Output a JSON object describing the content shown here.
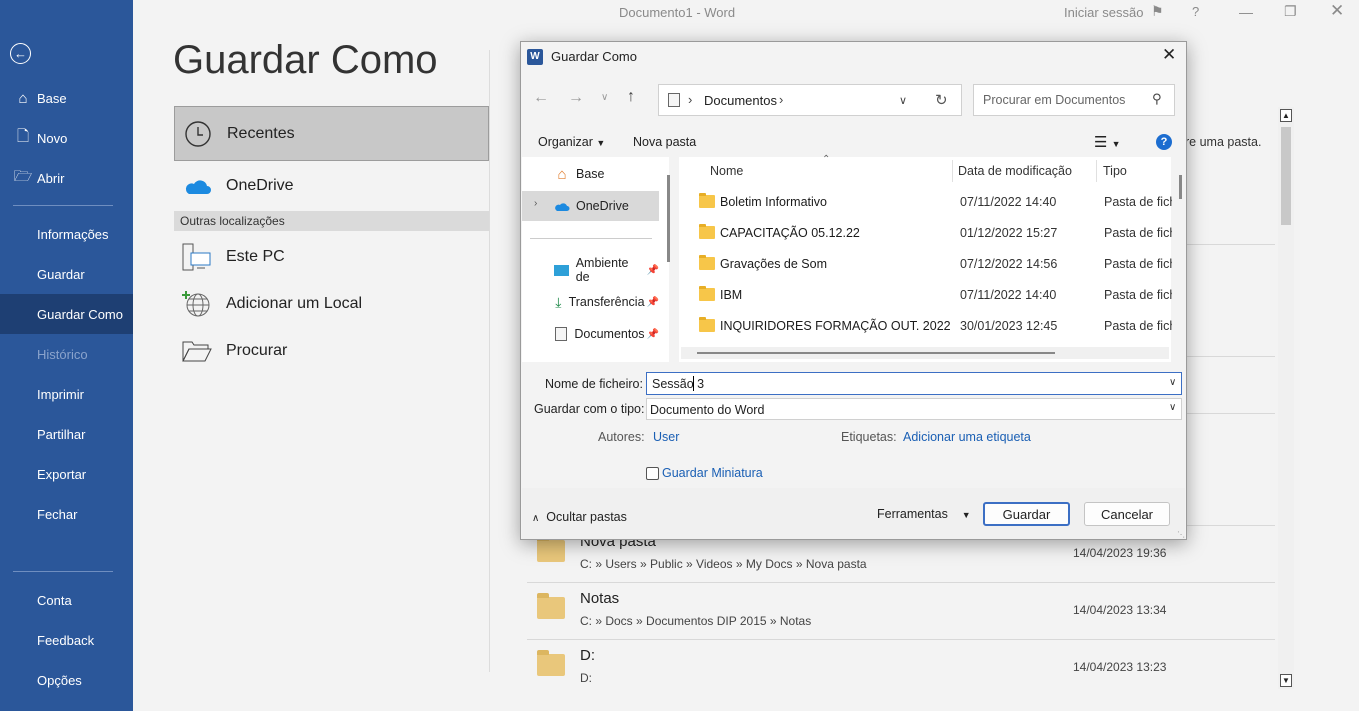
{
  "window": {
    "title": "Documento1  -  Word",
    "signin": "Iniciar sessão",
    "help": "?"
  },
  "rail": {
    "back": "back-arrow",
    "items": [
      {
        "label": "Base",
        "icon": "home-icon"
      },
      {
        "label": "Novo",
        "icon": "new-doc-icon"
      },
      {
        "label": "Abrir",
        "icon": "open-folder-icon"
      },
      {
        "label": "Informações"
      },
      {
        "label": "Guardar"
      },
      {
        "label": "Guardar Como"
      },
      {
        "label": "Histórico"
      },
      {
        "label": "Imprimir"
      },
      {
        "label": "Partilhar"
      },
      {
        "label": "Exportar"
      },
      {
        "label": "Fechar"
      },
      {
        "label": "Conta"
      },
      {
        "label": "Feedback"
      },
      {
        "label": "Opções"
      }
    ]
  },
  "main": {
    "title": "Guardar Como",
    "recent": "Recentes",
    "onedrive": "OneDrive",
    "other_header": "Outras localizações",
    "this_pc": "Este PC",
    "add_place": "Adicionar um Local",
    "browse": "Procurar",
    "hint_partial": "re uma pasta.",
    "recent_folders": [
      {
        "name": "Nova pasta",
        "path": "C: » Users » Public » Videos » My Docs » Nova pasta",
        "date": "14/04/2023 19:36"
      },
      {
        "name": "Notas",
        "path": "C: » Docs » Documentos DIP 2015 » Notas",
        "date": "14/04/2023 13:34"
      },
      {
        "name": "D:",
        "path": "D:",
        "date": "14/04/2023 13:23"
      }
    ]
  },
  "dialog": {
    "title": "Guardar Como",
    "breadcrumb": "Documentos",
    "search_placeholder": "Procurar em Documentos",
    "organize": "Organizar",
    "new_folder": "Nova pasta",
    "nav": [
      {
        "label": "Base"
      },
      {
        "label": "OneDrive"
      },
      {
        "label": "Ambiente de"
      },
      {
        "label": "Transferência"
      },
      {
        "label": "Documentos"
      }
    ],
    "columns": {
      "name": "Nome",
      "date": "Data de modificação",
      "type": "Tipo"
    },
    "files": [
      {
        "name": "Boletim Informativo",
        "date": "07/11/2022 14:40",
        "type": "Pasta de fich"
      },
      {
        "name": "CAPACITAÇÃO 05.12.22",
        "date": "01/12/2022 15:27",
        "type": "Pasta de fich"
      },
      {
        "name": "Gravações de Som",
        "date": "07/12/2022 14:56",
        "type": "Pasta de fich"
      },
      {
        "name": "IBM",
        "date": "07/11/2022 14:40",
        "type": "Pasta de fich"
      },
      {
        "name": "INQUIRIDORES FORMAÇÃO OUT. 2022",
        "date": "30/01/2023 12:45",
        "type": "Pasta de fich"
      }
    ],
    "filename_label": "Nome de ficheiro:",
    "filename_value": "Sessão 3",
    "type_label": "Guardar com o tipo:",
    "type_value": "Documento do Word",
    "authors_label": "Autores:",
    "authors_value": "User",
    "tags_label": "Etiquetas:",
    "tags_value": "Adicionar uma etiqueta",
    "thumbnail": "Guardar Miniatura",
    "hide_folders": "Ocultar pastas",
    "tools": "Ferramentas",
    "save": "Guardar",
    "cancel": "Cancelar",
    "accent": "#3c6fc4"
  }
}
